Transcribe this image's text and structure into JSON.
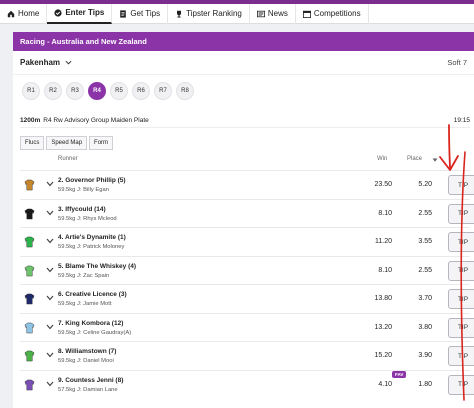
{
  "nav": {
    "items": [
      {
        "label": "Home",
        "icon": "home-icon"
      },
      {
        "label": "Enter Tips",
        "icon": "check-circle-icon",
        "active": true
      },
      {
        "label": "Get Tips",
        "icon": "document-icon"
      },
      {
        "label": "Tipster Ranking",
        "icon": "trophy-icon"
      },
      {
        "label": "News",
        "icon": "news-icon"
      },
      {
        "label": "Competitions",
        "icon": "calendar-icon"
      }
    ]
  },
  "header": {
    "title": "Racing - Australia and New Zealand"
  },
  "venue": {
    "name": "Pakenham",
    "track": "Soft 7"
  },
  "races": [
    "R1",
    "R2",
    "R3",
    "R4",
    "R5",
    "R6",
    "R7",
    "R8"
  ],
  "active_race": "R4",
  "race_info": {
    "distance": "1200m",
    "name": "R4 Rw Advisory Group Maiden Plate",
    "time": "19:15"
  },
  "tabs": [
    "Flucs",
    "Speed Map",
    "Form"
  ],
  "columns": {
    "runner": "Runner",
    "win": "Win",
    "place": "Place"
  },
  "colors": {
    "brand": "#8b34a8",
    "annotation": "#d9251d"
  },
  "runners": [
    {
      "name": "2. Governor Phillip (5)",
      "meta": "59.5kg J: Billy Egan",
      "win": "23.50",
      "place": "5.20",
      "tip": "TIP",
      "silk_color": "#c6862b"
    },
    {
      "name": "3. Iffycould (14)",
      "meta": "59.5kg J: Rhys Mcleod",
      "win": "8.10",
      "place": "2.55",
      "tip": "TIP",
      "silk_color": "#1a1a1a"
    },
    {
      "name": "4. Artie's Dynamite (1)",
      "meta": "59.5kg J: Patrick Moloney",
      "win": "11.20",
      "place": "3.55",
      "tip": "TIP",
      "silk_color": "#2cb24b"
    },
    {
      "name": "5. Blame The Whiskey (4)",
      "meta": "59.5kg J: Zac Spain",
      "win": "8.10",
      "place": "2.55",
      "tip": "TIP",
      "silk_color": "#6dc36b"
    },
    {
      "name": "6. Creative Licence (3)",
      "meta": "59.5kg J: Jamie Mott",
      "win": "13.80",
      "place": "3.70",
      "tip": "TIP",
      "silk_color": "#1f2a6b"
    },
    {
      "name": "7. King Kombora (12)",
      "meta": "59.5kg J: Celine Gaudray(A)",
      "win": "13.20",
      "place": "3.80",
      "tip": "TIP",
      "silk_color": "#8fc3e6"
    },
    {
      "name": "8. Williamstown (7)",
      "meta": "59.5kg J: Daniel Mooi",
      "win": "15.20",
      "place": "3.90",
      "tip": "TIP",
      "silk_color": "#4cb247"
    },
    {
      "name": "9. Countess Jenni (8)",
      "meta": "57.5kg J: Damian Lane",
      "win": "4.10",
      "place": "1.80",
      "tip": "TIP",
      "silk_color": "#7a4fb5",
      "badge": "FAV"
    }
  ]
}
